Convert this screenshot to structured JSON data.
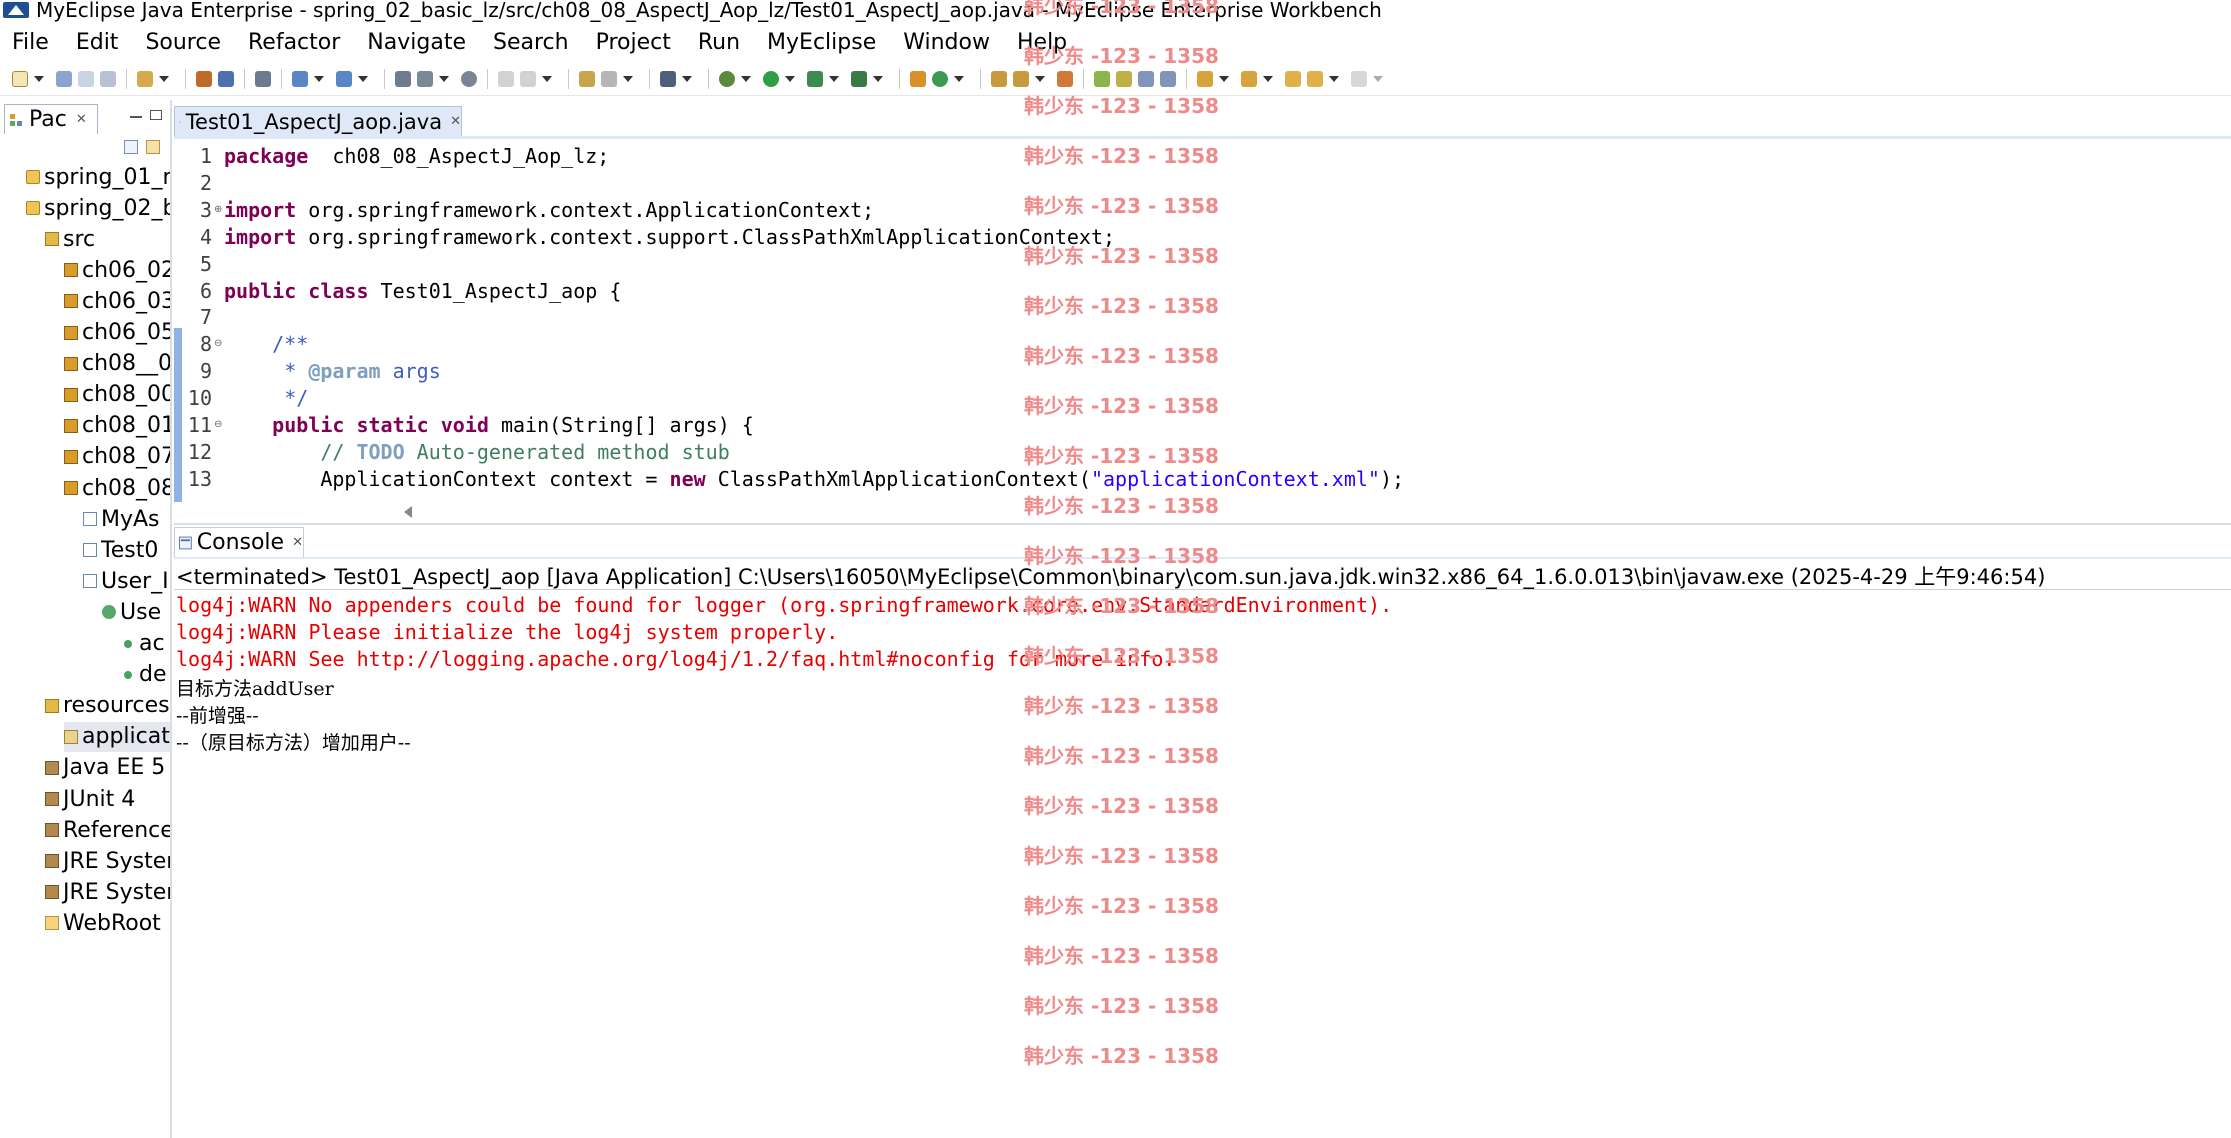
{
  "window": {
    "title": "MyEclipse Java Enterprise - spring_02_basic_lz/src/ch08_08_AspectJ_Aop_lz/Test01_AspectJ_aop.java - MyEclipse Enterprise Workbench"
  },
  "menu": {
    "items": [
      "File",
      "Edit",
      "Source",
      "Refactor",
      "Navigate",
      "Search",
      "Project",
      "Run",
      "MyEclipse",
      "Window",
      "Help"
    ]
  },
  "explorer": {
    "tab_label": "Pac",
    "close_glyph": "✕",
    "items": [
      {
        "label": "spring_01_n",
        "icon": "project-icon",
        "indent": 0
      },
      {
        "label": "spring_02_b",
        "icon": "project-icon",
        "indent": 0
      },
      {
        "label": "src",
        "icon": "source-folder-icon",
        "indent": 1
      },
      {
        "label": "ch06_02",
        "icon": "package-icon",
        "indent": 2
      },
      {
        "label": "ch06_03",
        "icon": "package-icon",
        "indent": 2
      },
      {
        "label": "ch06_05",
        "icon": "package-icon",
        "indent": 2
      },
      {
        "label": "ch08__0",
        "icon": "package-icon",
        "indent": 2
      },
      {
        "label": "ch08_00",
        "icon": "package-icon",
        "indent": 2
      },
      {
        "label": "ch08_01",
        "icon": "package-icon",
        "indent": 2
      },
      {
        "label": "ch08_07",
        "icon": "package-icon",
        "indent": 2
      },
      {
        "label": "ch08_08",
        "icon": "package-icon",
        "indent": 2
      },
      {
        "label": "MyAs",
        "icon": "java-file-icon",
        "indent": 3
      },
      {
        "label": "Test0",
        "icon": "java-file-icon",
        "indent": 3
      },
      {
        "label": "User_I",
        "icon": "java-file-icon",
        "indent": 3
      },
      {
        "label": "Use",
        "icon": "class-icon",
        "indent": 4
      },
      {
        "label": "ac",
        "icon": "method-icon",
        "indent": 5
      },
      {
        "label": "de",
        "icon": "method-icon",
        "indent": 5
      },
      {
        "label": "resources",
        "icon": "source-folder-icon",
        "indent": 1
      },
      {
        "label": "applicat",
        "icon": "xml-file-icon",
        "indent": 2,
        "selected": true
      },
      {
        "label": "Java EE 5",
        "icon": "library-icon",
        "indent": 1
      },
      {
        "label": "JUnit 4",
        "icon": "library-icon",
        "indent": 1
      },
      {
        "label": "Reference",
        "icon": "library-icon",
        "indent": 1
      },
      {
        "label": "JRE Syster",
        "icon": "library-icon",
        "indent": 1
      },
      {
        "label": "JRE Syster",
        "icon": "library-icon",
        "indent": 1
      },
      {
        "label": "WebRoot",
        "icon": "folder-icon",
        "indent": 1
      }
    ]
  },
  "editor": {
    "tab_label": "Test01_AspectJ_aop.java",
    "close_glyph": "✕",
    "lines": [
      {
        "n": "1",
        "fold": "",
        "html": [
          [
            "kw",
            "package"
          ],
          [
            "",
            "  ch08_08_AspectJ_Aop_lz;"
          ]
        ]
      },
      {
        "n": "2",
        "fold": "",
        "html": []
      },
      {
        "n": "3",
        "fold": "⊕",
        "html": [
          [
            "kw",
            "import"
          ],
          [
            "",
            " org.springframework.context.ApplicationContext;"
          ]
        ]
      },
      {
        "n": "4",
        "fold": "",
        "html": [
          [
            "kw",
            "import"
          ],
          [
            "",
            " org.springframework.context.support.ClassPathXmlApplicationContext;"
          ]
        ]
      },
      {
        "n": "5",
        "fold": "",
        "html": []
      },
      {
        "n": "6",
        "fold": "",
        "html": [
          [
            "kw",
            "public"
          ],
          [
            "",
            " "
          ],
          [
            "kw",
            "class"
          ],
          [
            "",
            " Test01_AspectJ_aop {"
          ]
        ]
      },
      {
        "n": "7",
        "fold": "",
        "html": []
      },
      {
        "n": "8",
        "fold": "⊖",
        "html": [
          [
            "",
            "    "
          ],
          [
            "jd",
            "/**"
          ]
        ]
      },
      {
        "n": "9",
        "fold": "",
        "html": [
          [
            "",
            "     "
          ],
          [
            "jd",
            "* "
          ],
          [
            "jt",
            "@param"
          ],
          [
            "jd",
            " args"
          ]
        ]
      },
      {
        "n": "10",
        "fold": "",
        "html": [
          [
            "",
            "     "
          ],
          [
            "jd",
            "*/"
          ]
        ]
      },
      {
        "n": "11",
        "fold": "⊖",
        "html": [
          [
            "",
            "    "
          ],
          [
            "kw",
            "public"
          ],
          [
            "",
            " "
          ],
          [
            "kw",
            "static"
          ],
          [
            "",
            " "
          ],
          [
            "kw",
            "void"
          ],
          [
            "",
            " main(String[] args) {"
          ]
        ]
      },
      {
        "n": "12",
        "fold": "",
        "html": [
          [
            "",
            "        "
          ],
          [
            "cm",
            "// "
          ],
          [
            "todo",
            "TODO"
          ],
          [
            "cm",
            " Auto-generated method stub"
          ]
        ]
      },
      {
        "n": "13",
        "fold": "",
        "html": [
          [
            "",
            "        ApplicationContext context = "
          ],
          [
            "kw",
            "new"
          ],
          [
            "",
            " ClassPathXmlApplicationContext("
          ],
          [
            "str",
            "\"applicationContext.xml\""
          ],
          [
            "",
            ");"
          ]
        ]
      }
    ]
  },
  "console": {
    "tab_label": "Console",
    "close_glyph": "✕",
    "status": "<terminated> Test01_AspectJ_aop [Java Application] C:\\Users\\16050\\MyEclipse\\Common\\binary\\com.sun.java.jdk.win32.x86_64_1.6.0.013\\bin\\javaw.exe (2025-4-29 上午9:46:54)",
    "output": [
      {
        "type": "err",
        "text": "log4j:WARN No appenders could be found for logger (org.springframework.core.env.StandardEnvironment)."
      },
      {
        "type": "err",
        "text": "log4j:WARN Please initialize the log4j system properly."
      },
      {
        "type": "err",
        "text": "log4j:WARN See http://logging.apache.org/log4j/1.2/faq.html#noconfig for more info."
      },
      {
        "type": "std",
        "text": "目标方法addUser"
      },
      {
        "type": "std",
        "text": "--前增强--"
      },
      {
        "type": "std",
        "text": "--（原目标方法）增加用户--"
      }
    ]
  },
  "watermark": {
    "text": "韩少东 -123 - 1358",
    "count": 22
  },
  "colors": {
    "keyword": "#7f0055",
    "comment": "#3f7f5f",
    "javadoc": "#3f5fbf",
    "string": "#2a00ff",
    "console_error": "#e60000",
    "watermark": "#ee8a8a"
  }
}
